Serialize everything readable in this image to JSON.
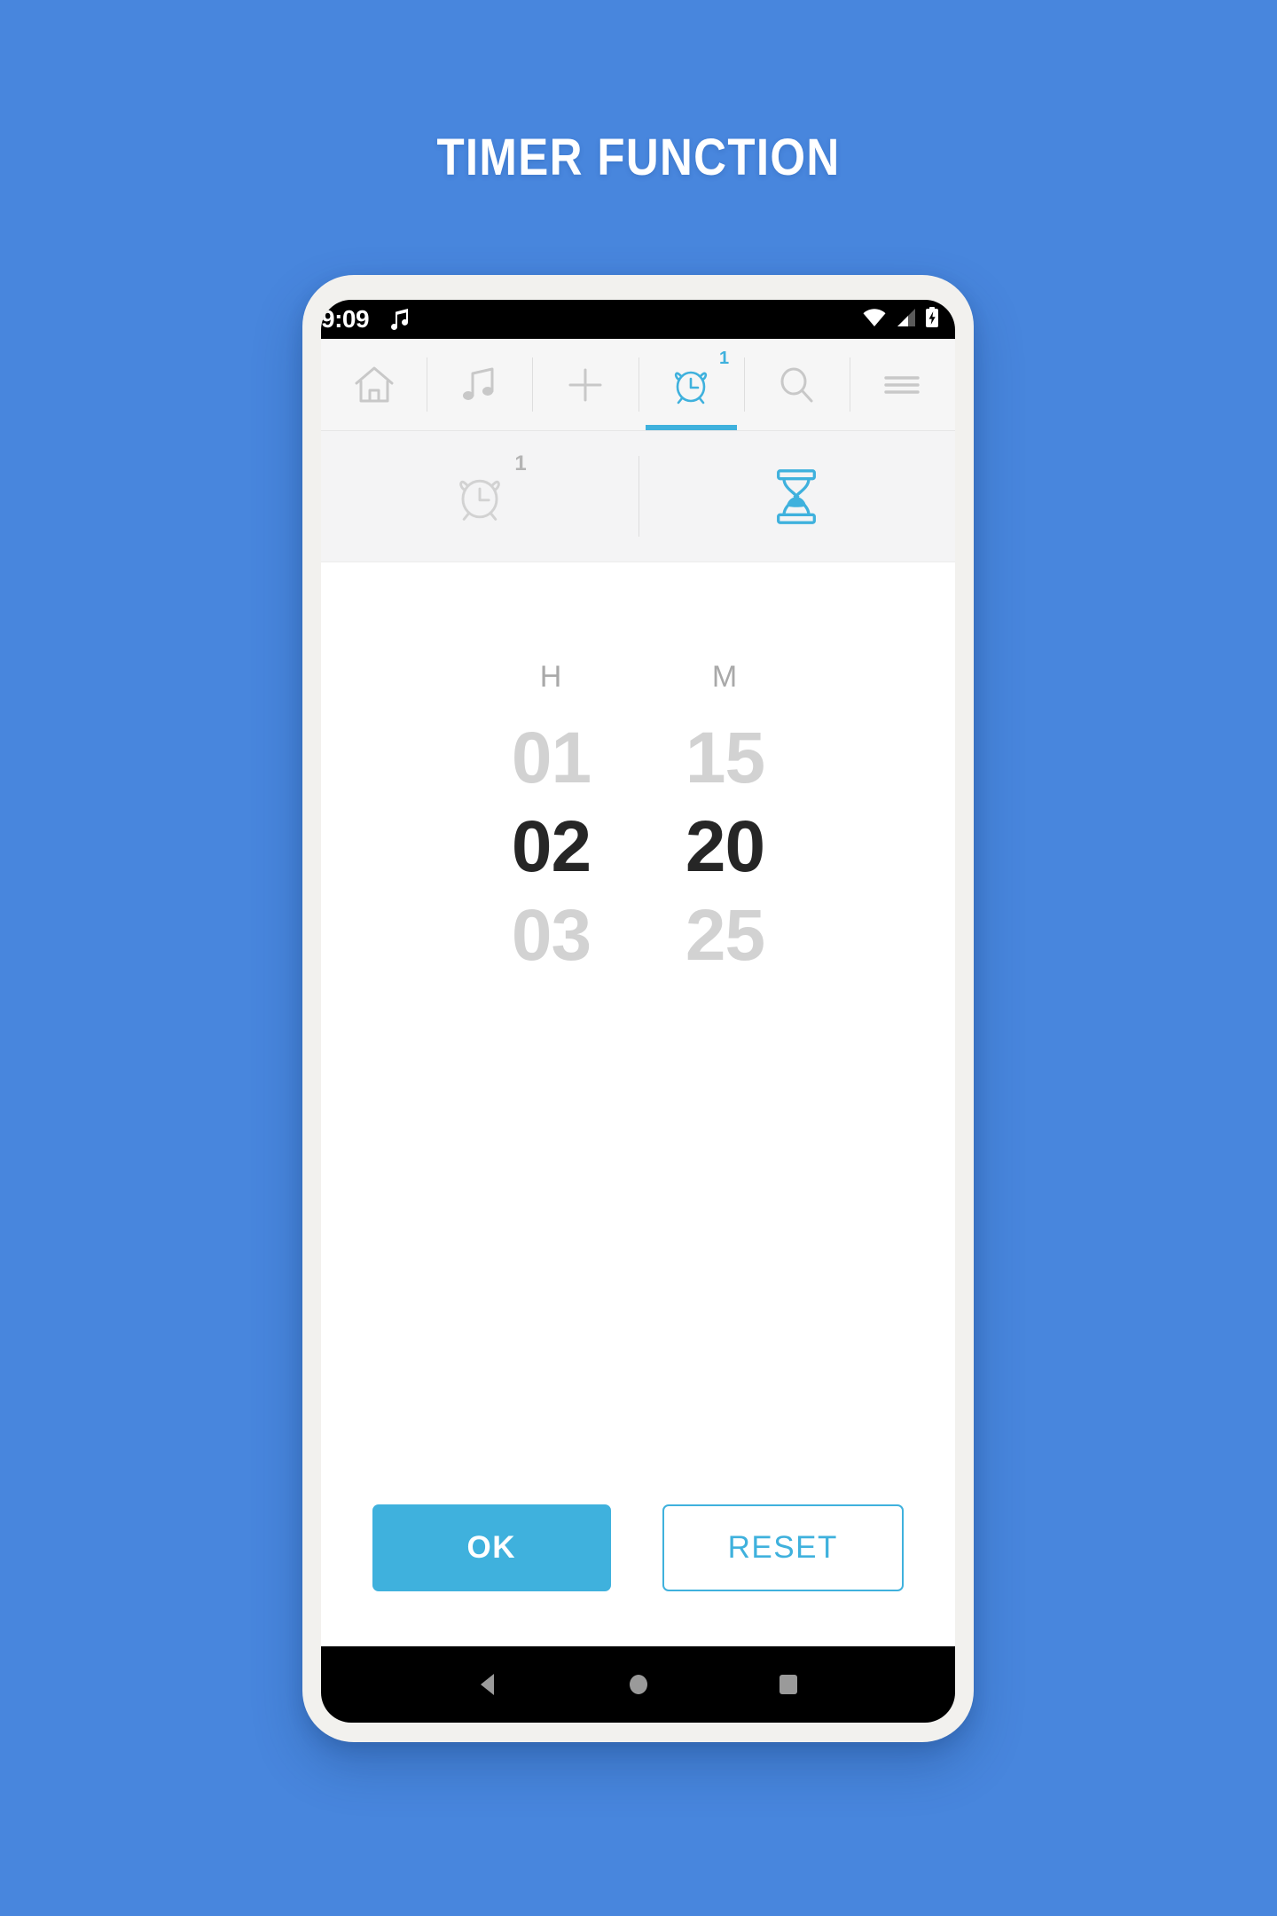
{
  "page": {
    "title": "TIMER FUNCTION",
    "background_color": "#4886dd",
    "accent_color": "#3fb1dd"
  },
  "status_bar": {
    "time": "9:09",
    "icons": [
      "music-note-icon",
      "wifi-icon",
      "cellular-signal-icon",
      "battery-charging-icon"
    ]
  },
  "top_nav": {
    "items": [
      {
        "name": "home",
        "icon": "home-icon",
        "active": false,
        "badge": ""
      },
      {
        "name": "music",
        "icon": "music-note-icon",
        "active": false,
        "badge": ""
      },
      {
        "name": "add",
        "icon": "plus-icon",
        "active": false,
        "badge": ""
      },
      {
        "name": "alarm",
        "icon": "alarm-clock-icon",
        "active": true,
        "badge": "1"
      },
      {
        "name": "search",
        "icon": "search-icon",
        "active": false,
        "badge": ""
      },
      {
        "name": "menu",
        "icon": "hamburger-menu-icon",
        "active": false,
        "badge": ""
      }
    ]
  },
  "sub_nav": {
    "items": [
      {
        "name": "alarm",
        "icon": "alarm-clock-icon",
        "active": false,
        "badge": "1"
      },
      {
        "name": "timer",
        "icon": "hourglass-icon",
        "active": true,
        "badge": ""
      }
    ]
  },
  "timer_picker": {
    "columns": [
      {
        "label": "H",
        "unit": "hours",
        "above": "01",
        "selected": "02",
        "below": "03"
      },
      {
        "label": "M",
        "unit": "minutes",
        "above": "15",
        "selected": "20",
        "below": "25"
      }
    ]
  },
  "actions": {
    "ok_label": "OK",
    "reset_label": "RESET"
  },
  "android_nav": {
    "back": "back-triangle-icon",
    "home": "home-circle-icon",
    "recents": "recents-square-icon"
  }
}
